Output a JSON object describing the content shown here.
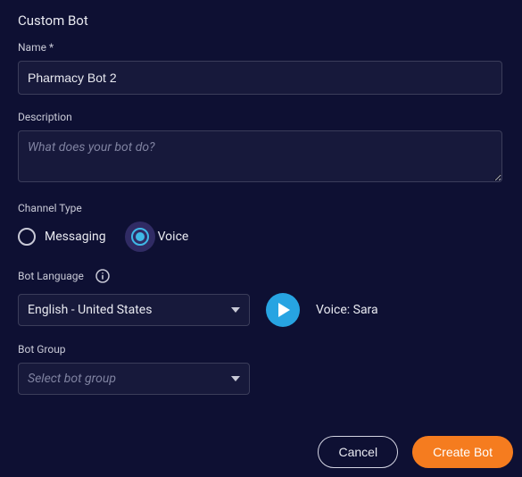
{
  "section": {
    "title": "Custom Bot"
  },
  "name": {
    "label": "Name *",
    "value": "Pharmacy Bot 2"
  },
  "description": {
    "label": "Description",
    "placeholder": "What does your bot do?",
    "value": ""
  },
  "channelType": {
    "label": "Channel Type",
    "options": {
      "messaging": "Messaging",
      "voice": "Voice"
    },
    "selected": "voice"
  },
  "botLanguage": {
    "label": "Bot Language",
    "selected": "English - United States",
    "voiceLabel": "Voice:",
    "voiceName": "Sara"
  },
  "botGroup": {
    "label": "Bot Group",
    "placeholder": "Select bot group"
  },
  "buttons": {
    "cancel": "Cancel",
    "create": "Create Bot"
  },
  "icons": {
    "info": "info-icon",
    "play": "play-icon",
    "chevronDown": "chevron-down-icon"
  }
}
